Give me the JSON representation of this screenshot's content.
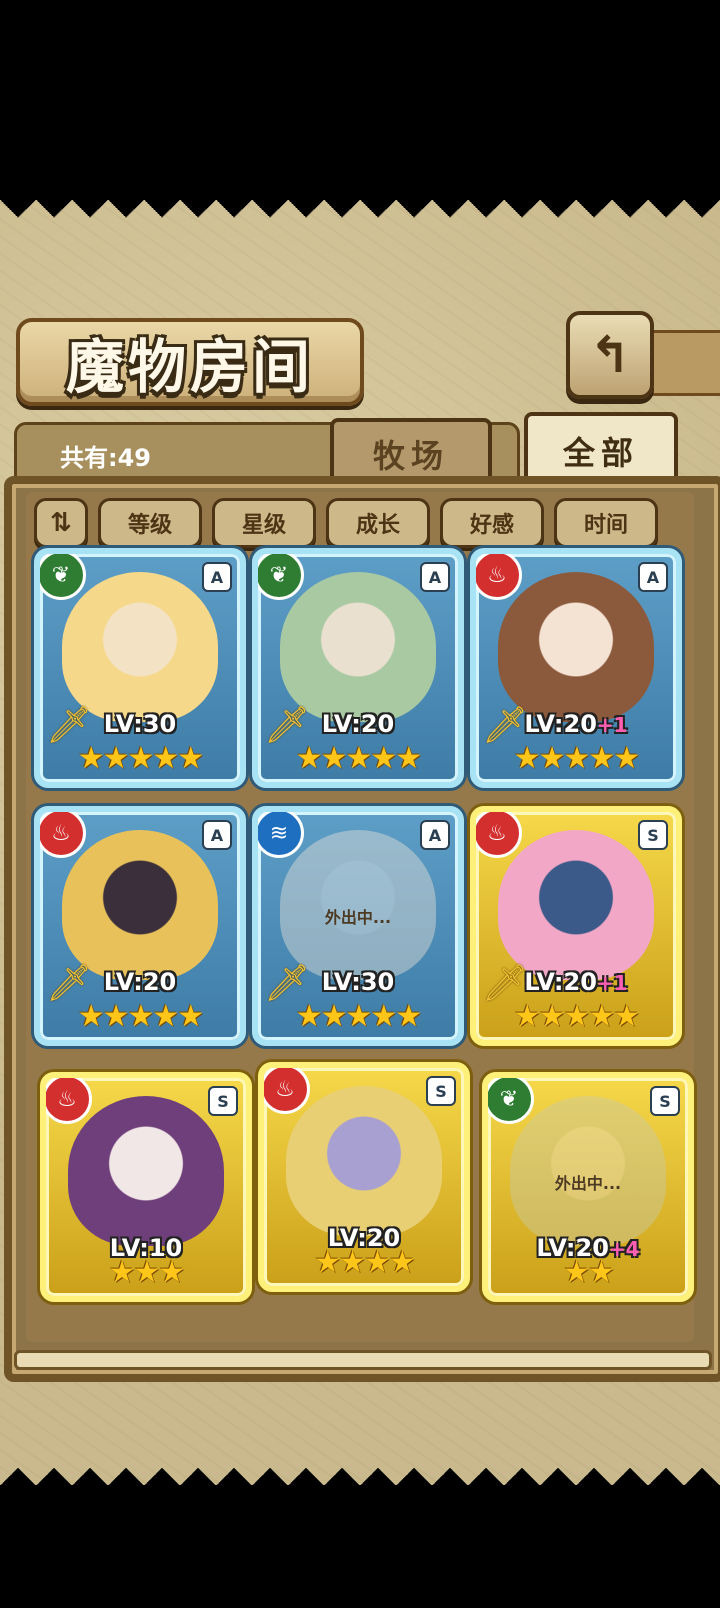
{
  "title": "魔物房间",
  "back_icon_glyph": "↰",
  "count_label": "共有:49",
  "tabs": {
    "ranch": "牧场",
    "all": "全部"
  },
  "filters": {
    "sort_glyph": "⇅",
    "items": [
      "等级",
      "星级",
      "成长",
      "好感",
      "时间"
    ]
  },
  "away_text": "外出中...",
  "cards": [
    {
      "element": "grass",
      "element_glyph": "❦",
      "grade": "A",
      "level": "LV:30",
      "plus": "",
      "stars": "★★★★★",
      "frame": "blue",
      "away": false,
      "portrait_colors": [
        "#f6d88a",
        "#f3e2c4"
      ]
    },
    {
      "element": "grass",
      "element_glyph": "❦",
      "grade": "A",
      "level": "LV:20",
      "plus": "",
      "stars": "★★★★★",
      "frame": "blue",
      "away": false,
      "portrait_colors": [
        "#a9c9a3",
        "#e9e0cf"
      ]
    },
    {
      "element": "fire",
      "element_glyph": "♨",
      "grade": "A",
      "level": "LV:20",
      "plus": "+1",
      "stars": "★★★★★",
      "frame": "blue",
      "away": false,
      "portrait_colors": [
        "#8b5a3c",
        "#f4e2d2"
      ]
    },
    {
      "element": "fire",
      "element_glyph": "♨",
      "grade": "A",
      "level": "LV:20",
      "plus": "",
      "stars": "★★★★★",
      "frame": "blue",
      "away": false,
      "portrait_colors": [
        "#e8c15a",
        "#3a2f3a"
      ]
    },
    {
      "element": "water",
      "element_glyph": "≋",
      "grade": "A",
      "level": "LV:30",
      "plus": "",
      "stars": "★★★★★",
      "frame": "blue",
      "away": true,
      "portrait_colors": [
        "#e6e1d6",
        "#f5efe6"
      ]
    },
    {
      "element": "fire",
      "element_glyph": "♨",
      "grade": "S",
      "level": "LV:20",
      "plus": "+1",
      "stars": "★★★★★",
      "frame": "gold",
      "away": false,
      "portrait_colors": [
        "#f2a7c6",
        "#3b5a8a"
      ]
    },
    {
      "element": "fire",
      "element_glyph": "♨",
      "grade": "S",
      "level": "LV:10",
      "plus": "",
      "stars": "★★★",
      "frame": "gold",
      "away": false,
      "portrait_colors": [
        "#6e3f7a",
        "#f1e7e7"
      ]
    },
    {
      "element": "fire",
      "element_glyph": "♨",
      "grade": "S",
      "level": "LV:20",
      "plus": "",
      "stars": "★★★★",
      "frame": "gold",
      "away": false,
      "portrait_colors": [
        "#e9cf74",
        "#a8a0d0"
      ]
    },
    {
      "element": "grass",
      "element_glyph": "❦",
      "grade": "S",
      "level": "LV:20",
      "plus": "+4",
      "stars": "★★",
      "frame": "gold",
      "away": true,
      "portrait_colors": [
        "#c9c9a6",
        "#e2dcc4"
      ]
    }
  ]
}
